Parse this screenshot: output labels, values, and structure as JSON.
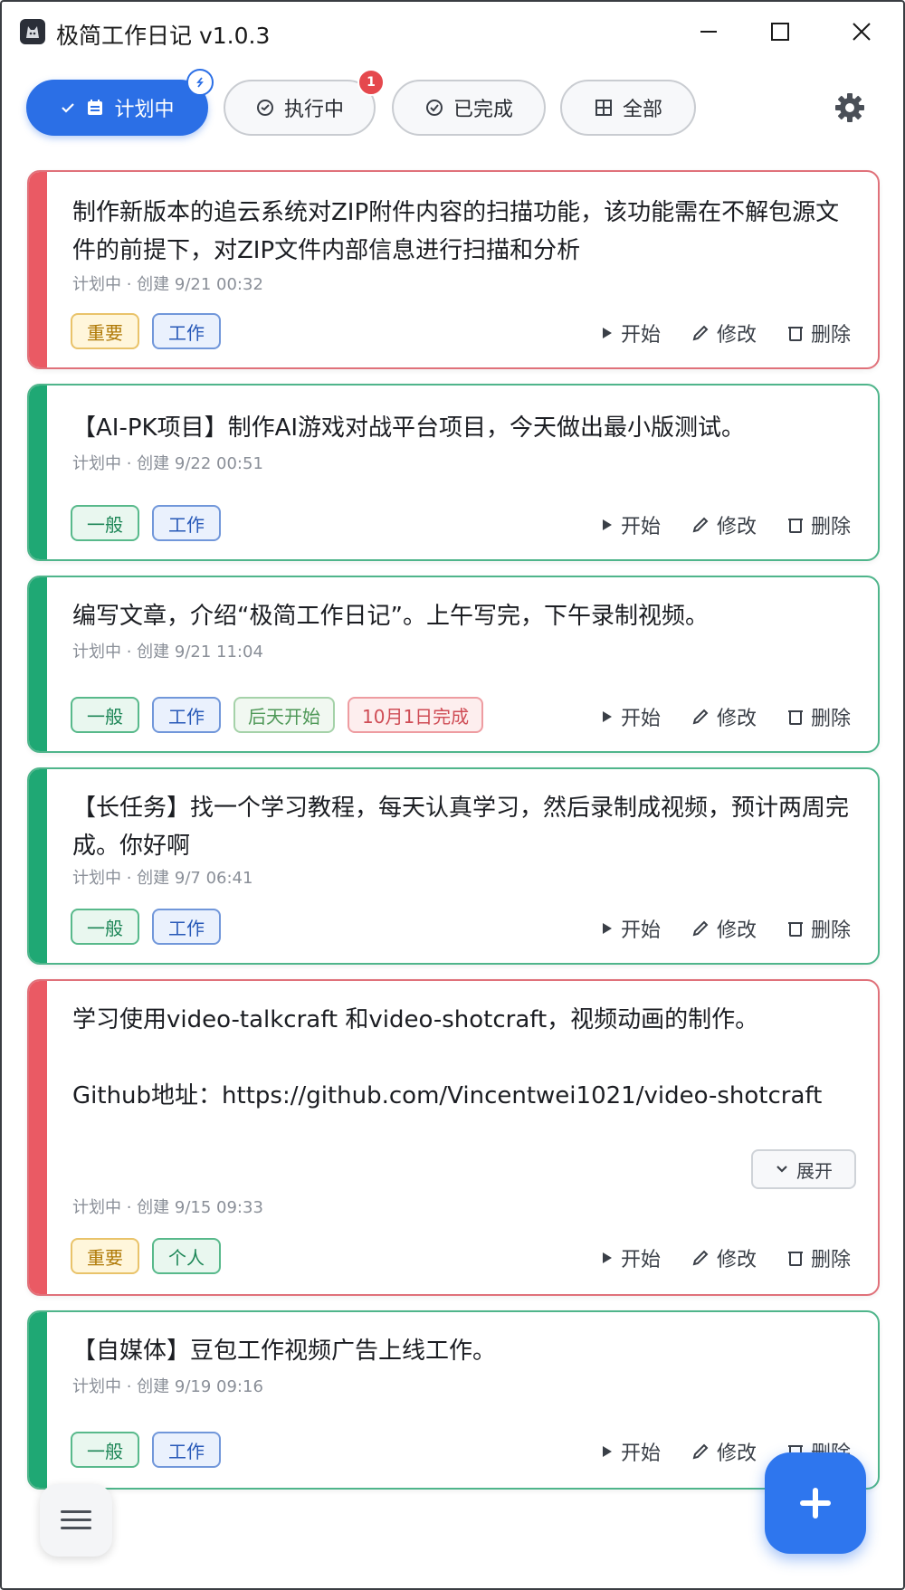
{
  "window": {
    "title": "极简工作日记 v1.0.3"
  },
  "tabs": [
    {
      "label": "计划中",
      "icon": "calendar-icon",
      "active": true,
      "badge": ""
    },
    {
      "label": "执行中",
      "icon": "clock-icon",
      "active": false,
      "badge": "1"
    },
    {
      "label": "已完成",
      "icon": "check-circle-icon",
      "active": false,
      "badge": ""
    },
    {
      "label": "全部",
      "icon": "grid-icon",
      "active": false,
      "badge": ""
    }
  ],
  "actions": {
    "start": "开始",
    "edit": "修改",
    "delete": "删除",
    "expand": "展开"
  },
  "tasks": [
    {
      "priority": "important",
      "content": "制作新版本的追云系统对ZIP附件内容的扫描功能，该功能需在不解包源文件的前提下，对ZIP文件内部信息进行扫描和分析",
      "meta": "计划中 · 创建 9/21 00:32",
      "tags": [
        "重要",
        "工作"
      ]
    },
    {
      "priority": "normal",
      "content": "【AI-PK项目】制作AI游戏对战平台项目，今天做出最小版测试。",
      "meta": "计划中 · 创建 9/22 00:51",
      "tags": [
        "一般",
        "工作"
      ]
    },
    {
      "priority": "normal",
      "content": "编写文章，介绍“极简工作日记”。上午写完，下午录制视频。",
      "meta": "计划中 · 创建 9/21 11:04",
      "tags": [
        "一般",
        "工作",
        "后天开始",
        "10月1日完成"
      ]
    },
    {
      "priority": "normal",
      "content": "【长任务】找一个学习教程，每天认真学习，然后录制成视频，预计两周完成。你好啊",
      "meta": "计划中 · 创建 9/7 06:41",
      "tags": [
        "一般",
        "工作"
      ]
    },
    {
      "priority": "important",
      "content": "学习使用video-talkcraft 和video-shotcraft，视频动画的制作。\n\nGithub地址：https://github.com/Vincentwei1021/video-shotcraft",
      "meta": "计划中 · 创建 9/15 09:33",
      "tags": [
        "重要",
        "个人"
      ]
    },
    {
      "priority": "normal",
      "content": "【自媒体】豆包工作视频广告上线工作。",
      "meta": "计划中 · 创建 9/19 09:16",
      "tags": [
        "一般",
        "工作"
      ]
    }
  ],
  "colors": {
    "accent": "#2b6fe6",
    "important_stripe": "#ea5a64",
    "normal_stripe": "#1fa874",
    "badge_red": "#e5484d"
  }
}
